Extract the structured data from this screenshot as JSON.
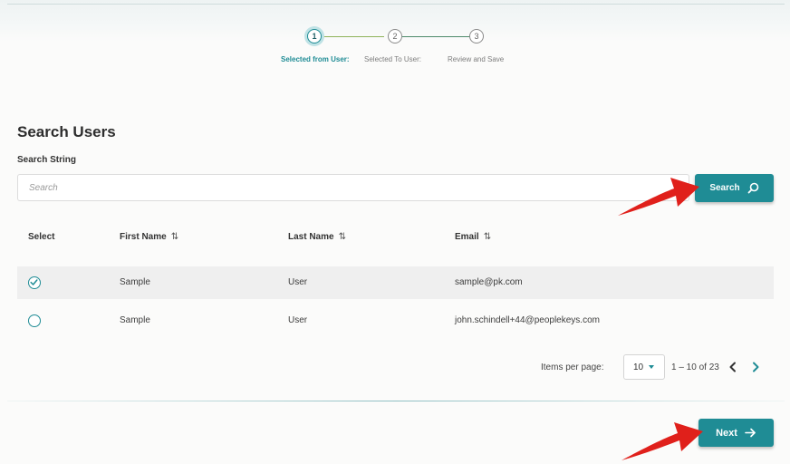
{
  "stepper": {
    "steps": [
      {
        "number": "1",
        "label": "Selected from User:",
        "active": true
      },
      {
        "number": "2",
        "label": "Selected To User:",
        "active": false
      },
      {
        "number": "3",
        "label": "Review and Save",
        "active": false
      }
    ]
  },
  "search": {
    "title": "Search Users",
    "field_label": "Search String",
    "placeholder": "Search",
    "value": "",
    "button_label": "Search"
  },
  "table": {
    "headers": [
      "Select",
      "First Name",
      "Last Name",
      "Email"
    ],
    "rows": [
      {
        "selected": true,
        "first_name": "Sample",
        "last_name": "User",
        "email": "sample@pk.com"
      },
      {
        "selected": false,
        "first_name": "Sample",
        "last_name": "User",
        "email": "john.schindell+44@peoplekeys.com"
      }
    ]
  },
  "paginator": {
    "items_per_page_label": "Items per page:",
    "page_size": "10",
    "range": "1 – 10 of 23"
  },
  "footer": {
    "next_label": "Next"
  },
  "colors": {
    "accent": "#1f8c95",
    "annotation_arrow": "#e0201b"
  },
  "icons": [
    "search-icon",
    "sort-icon",
    "check-icon",
    "chevron-left-icon",
    "chevron-right-icon",
    "arrow-right-icon",
    "caret-down-icon"
  ]
}
